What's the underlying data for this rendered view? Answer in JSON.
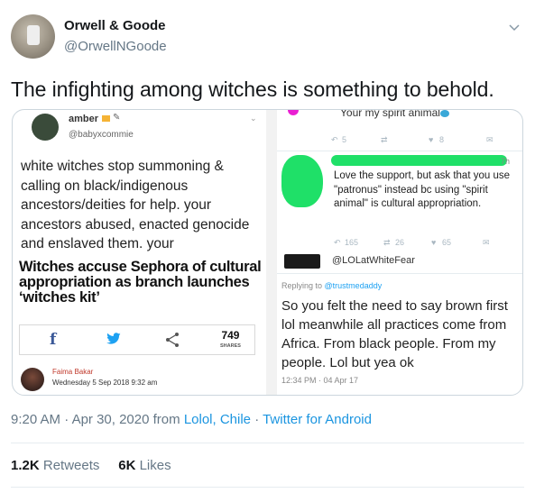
{
  "author": {
    "name": "Orwell & Goode",
    "handle": "@OrwellNGoode"
  },
  "tweet": {
    "text": "The infighting among witches is something to behold.",
    "time": "9:20 AM",
    "date": "Apr 30, 2020",
    "from_prefix": "from",
    "location": "Lolol, Chile",
    "client": "Twitter for Android"
  },
  "stats": {
    "retweets_count": "1.2K",
    "retweets_label": "Retweets",
    "likes_count": "6K",
    "likes_label": "Likes"
  },
  "media": {
    "left": {
      "user_name": "amber",
      "user_handle": "@babyxcommie",
      "body": "white witches stop summoning & calling on black/indigenous ancestors/deities for help. your ancestors abused, enacted genocide and enslaved them. your",
      "headline": "Witches accuse Sephora of cultural appropriation as branch launches ‘witches kit’",
      "share_icons": [
        "facebook-icon",
        "twitter-icon",
        "share-icon"
      ],
      "facebook_glyph": "f",
      "share_count": "749",
      "share_label": "SHARES",
      "article_author": "Faima Bakar",
      "article_date": "Wednesday 5 Sep 2018 9:32 am"
    },
    "right": {
      "top_text": "Your my spirit animal",
      "top_actions": {
        "replies": "5",
        "likes": "8"
      },
      "reply1_time": "7h",
      "reply1_text": "Love the support, but ask that you use \"patronus\" instead bc using \"spirit animal\" is cultural appropriation.",
      "reply1_actions": {
        "replies": "165",
        "retweets": "26",
        "likes": "65"
      },
      "reply2_handle": "@LOLatWhiteFear",
      "replying_prefix": "Replying to",
      "replying_to": "@trustmedaddy",
      "reply2_text": "So you felt the need to say brown first lol meanwhile all practices come from Africa. From black people. From my people. Lol but yea ok",
      "reply2_date": "12:34 PM · 04 Apr 17"
    }
  },
  "colors": {
    "link": "#1b95e0",
    "secondary": "#657786",
    "highlight_green": "#1fe068",
    "facebook": "#3b5998",
    "twitter": "#1da1f2"
  }
}
